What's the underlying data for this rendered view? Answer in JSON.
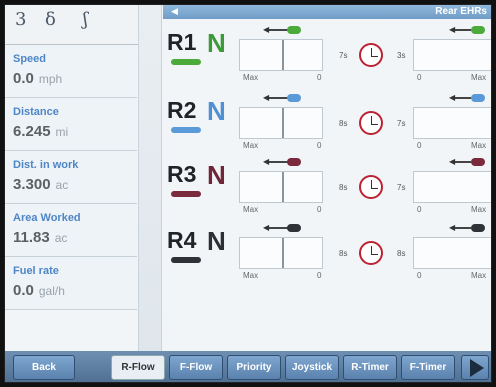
{
  "header": {
    "title": "Rear EHRs",
    "glyphs": [
      "3",
      "δ",
      "ʃ"
    ]
  },
  "stats": [
    {
      "label": "Speed",
      "value": "0.0",
      "unit": "mph"
    },
    {
      "label": "Distance",
      "value": "6.245",
      "unit": "mi"
    },
    {
      "label": "Dist. in work",
      "value": "3.300",
      "unit": "ac"
    },
    {
      "label": "Area Worked",
      "value": "11.83",
      "unit": "ac"
    },
    {
      "label": "Fuel rate",
      "value": "0.0",
      "unit": "gal/h"
    }
  ],
  "remotes": [
    {
      "name": "R1",
      "mode": "N",
      "mode_color": "#3c9a3a",
      "color": "#4caa3a",
      "timer_left": "7s",
      "timer_right": "3s",
      "max_label": "Max",
      "zero_label": "0",
      "right_label": "Max"
    },
    {
      "name": "R2",
      "mode": "N",
      "mode_color": "#4f8fd4",
      "color": "#5a9ad8",
      "timer_left": "8s",
      "timer_right": "7s",
      "max_label": "Max",
      "zero_label": "0",
      "right_label": "Max"
    },
    {
      "name": "R3",
      "mode": "N",
      "mode_color": "#6e2638",
      "color": "#7a2a3c",
      "timer_left": "8s",
      "timer_right": "7s",
      "max_label": "Max",
      "zero_label": "0",
      "right_label": "Max"
    },
    {
      "name": "R4",
      "mode": "N",
      "mode_color": "#2c2f33",
      "color": "#2f3236",
      "timer_left": "8s",
      "timer_right": "8s",
      "max_label": "Max",
      "zero_label": "0",
      "right_label": "Max"
    }
  ],
  "bottom": {
    "back": "Back",
    "tabs": [
      "R-Flow",
      "F-Flow",
      "Priority",
      "Joystick",
      "R-Timer",
      "F-Timer"
    ],
    "active_tab": "R-Flow"
  }
}
